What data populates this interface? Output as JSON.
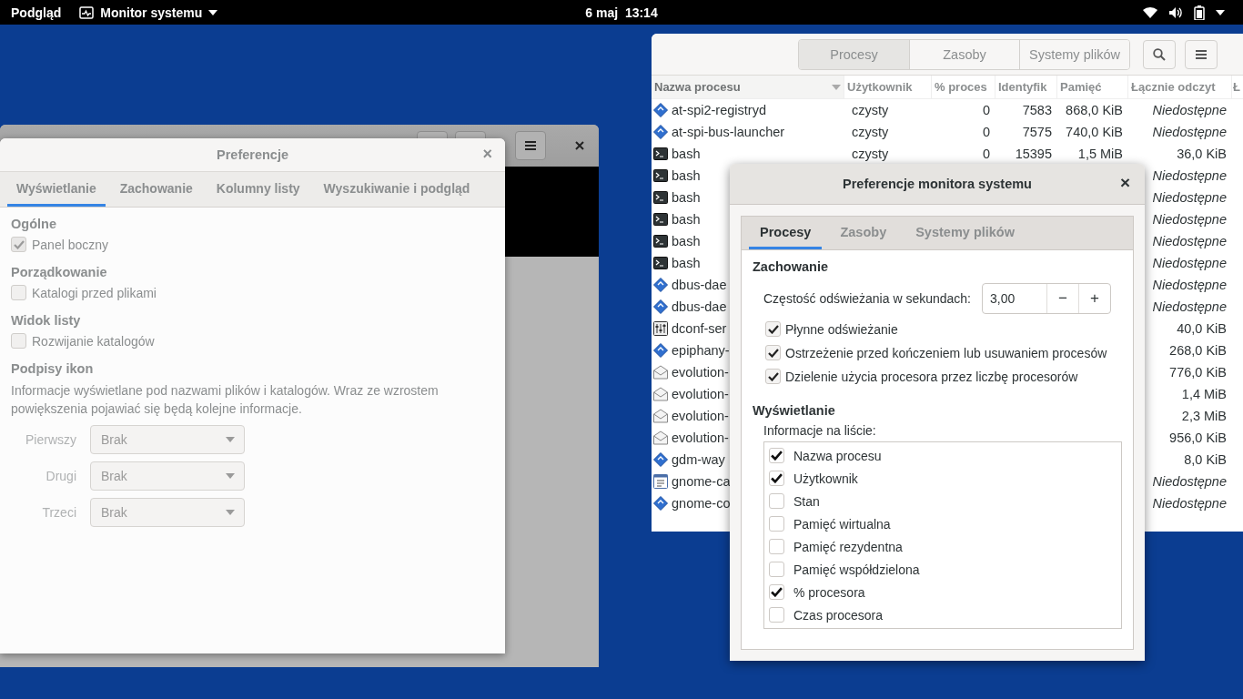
{
  "top_bar": {
    "activities": "Podgląd",
    "app_menu": "Monitor systemu",
    "clock": "6 maj  13:14"
  },
  "files_preferences": {
    "title": "Preferencje",
    "close": "×",
    "backdrop": true,
    "tabs": [
      {
        "label": "Wyświetlanie",
        "selected": true
      },
      {
        "label": "Zachowanie",
        "selected": false
      },
      {
        "label": "Kolumny listy",
        "selected": false
      },
      {
        "label": "Wyszukiwanie i podgląd",
        "selected": false
      }
    ],
    "sections": [
      {
        "heading": "Ogólne",
        "checkboxes": [
          {
            "label": "Panel boczny",
            "checked": true
          }
        ]
      },
      {
        "heading": "Porządkowanie",
        "checkboxes": [
          {
            "label": "Katalogi przed plikami",
            "checked": false
          }
        ]
      },
      {
        "heading": "Widok listy",
        "checkboxes": [
          {
            "label": "Rozwijanie katalogów",
            "checked": false
          }
        ]
      },
      {
        "heading": "Podpisy ikon",
        "description": "Informacje wyświetlane pod nazwami plików i katalogów. Wraz ze wzrostem powiększenia pojawiać się będą kolejne informacje.",
        "dropdowns": [
          {
            "label": "Pierwszy",
            "value": "Brak"
          },
          {
            "label": "Drugi",
            "value": "Brak"
          },
          {
            "label": "Trzeci",
            "value": "Brak"
          }
        ]
      }
    ]
  },
  "system_monitor": {
    "backdrop": true,
    "tabs": [
      {
        "label": "Procesy",
        "selected": true
      },
      {
        "label": "Zasoby",
        "selected": false
      },
      {
        "label": "Systemy plików",
        "selected": false
      }
    ],
    "columns": [
      {
        "label": "Nazwa procesu",
        "sorted": true
      },
      {
        "label": "Użytkownik",
        "sorted": false
      },
      {
        "label": "% proces",
        "sorted": false
      },
      {
        "label": "Identyfik",
        "sorted": false
      },
      {
        "label": "Pamięć",
        "sorted": false
      },
      {
        "label": "Łącznie odczyt",
        "sorted": false
      },
      {
        "label": "Ł",
        "sorted": false
      }
    ],
    "rows": [
      {
        "kind": "app",
        "name": "at-spi2-registryd",
        "user": "czysty",
        "cpu": "0",
        "pid": "7583",
        "memory": "868,0 KiB",
        "disk_read": "Niedostępne",
        "disk_read_na": true
      },
      {
        "kind": "app",
        "name": "at-spi-bus-launcher",
        "user": "czysty",
        "cpu": "0",
        "pid": "7575",
        "memory": "740,0 KiB",
        "disk_read": "Niedostępne",
        "disk_read_na": true
      },
      {
        "kind": "terminal",
        "name": "bash",
        "user": "czysty",
        "cpu": "0",
        "pid": "15395",
        "memory": "1,5 MiB",
        "disk_read": "36,0 KiB",
        "disk_read_na": false
      },
      {
        "kind": "terminal",
        "name": "bash",
        "disk_read": "Niedostępne",
        "disk_read_na": true
      },
      {
        "kind": "terminal",
        "name": "bash",
        "disk_read": "Niedostępne",
        "disk_read_na": true
      },
      {
        "kind": "terminal",
        "name": "bash",
        "disk_read": "Niedostępne",
        "disk_read_na": true
      },
      {
        "kind": "terminal",
        "name": "bash",
        "disk_read": "Niedostępne",
        "disk_read_na": true
      },
      {
        "kind": "terminal",
        "name": "bash",
        "disk_read": "Niedostępne",
        "disk_read_na": true
      },
      {
        "kind": "app",
        "name": "dbus-dae",
        "disk_read": "Niedostępne",
        "disk_read_na": true
      },
      {
        "kind": "app",
        "name": "dbus-dae",
        "disk_read": "Niedostępne",
        "disk_read_na": true
      },
      {
        "kind": "settings",
        "name": "dconf-ser",
        "disk_read": "40,0 KiB",
        "disk_read_na": false
      },
      {
        "kind": "app",
        "name": "epiphany-",
        "disk_read": "268,0 KiB",
        "disk_read_na": false
      },
      {
        "kind": "mail",
        "name": "evolution-",
        "disk_read": "776,0 KiB",
        "disk_read_na": false
      },
      {
        "kind": "mail",
        "name": "evolution-",
        "disk_read": "1,4 MiB",
        "disk_read_na": false
      },
      {
        "kind": "mail",
        "name": "evolution-",
        "disk_read": "2,3 MiB",
        "disk_read_na": false
      },
      {
        "kind": "mail",
        "name": "evolution-",
        "disk_read": "956,0 KiB",
        "disk_read_na": false
      },
      {
        "kind": "app",
        "name": "gdm-way",
        "disk_read": "8,0 KiB",
        "disk_read_na": false
      },
      {
        "kind": "calendar",
        "name": "gnome-ca",
        "disk_read": "Niedostępne",
        "disk_read_na": true
      },
      {
        "kind": "app",
        "name": "gnome-co",
        "disk_read": "Niedostępne",
        "disk_read_na": true
      }
    ]
  },
  "monitor_preferences": {
    "title": "Preferencje monitora systemu",
    "close": "×",
    "tabs": [
      {
        "label": "Procesy",
        "selected": true
      },
      {
        "label": "Zasoby",
        "selected": false
      },
      {
        "label": "Systemy plików",
        "selected": false
      }
    ],
    "behavior_heading": "Zachowanie",
    "refresh": {
      "label": "Częstość odświeżania w sekundach:",
      "value": "3,00",
      "decrement": "−",
      "increment": "+"
    },
    "options": [
      {
        "label": "Płynne odświeżanie",
        "checked": true
      },
      {
        "label": "Ostrzeżenie przed kończeniem lub usuwaniem procesów",
        "checked": true
      },
      {
        "label": "Dzielenie użycia procesora przez liczbę procesorów",
        "checked": true
      }
    ],
    "display_heading": "Wyświetlanie",
    "list_label": "Informacje na liście:",
    "list_columns": [
      {
        "label": "Nazwa procesu",
        "checked": true
      },
      {
        "label": "Użytkownik",
        "checked": true
      },
      {
        "label": "Stan",
        "checked": false
      },
      {
        "label": "Pamięć wirtualna",
        "checked": false
      },
      {
        "label": "Pamięć rezydentna",
        "checked": false
      },
      {
        "label": "Pamięć współdzielona",
        "checked": false
      },
      {
        "label": "% procesora",
        "checked": true
      },
      {
        "label": "Czas procesora",
        "checked": false
      }
    ]
  }
}
